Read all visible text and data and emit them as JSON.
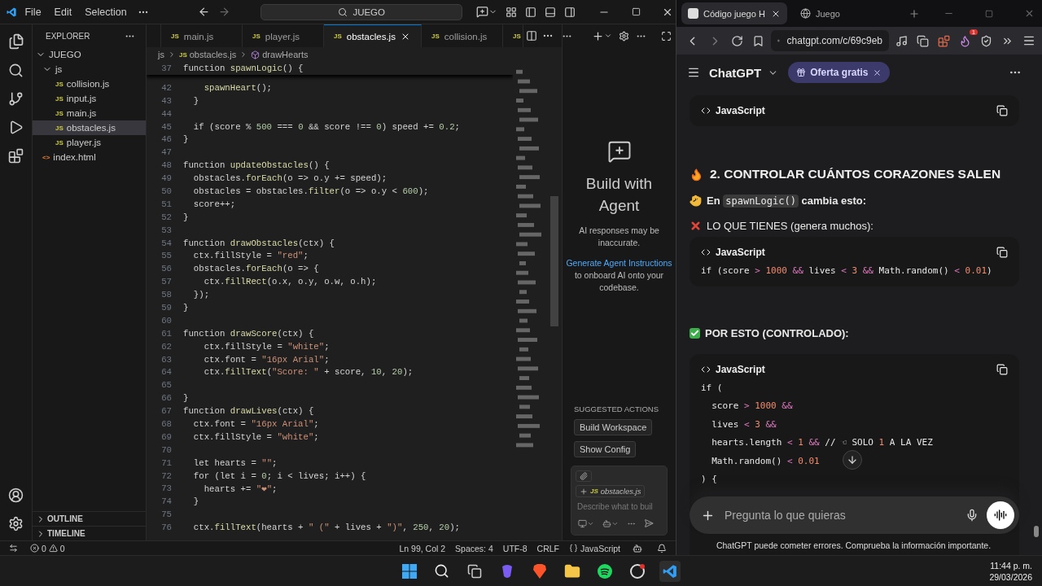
{
  "vscode": {
    "menu": [
      "File",
      "Edit",
      "Selection"
    ],
    "search": "JUEGO",
    "explorer": {
      "title": "EXPLORER",
      "root": {
        "label": "JUEGO",
        "expanded": true,
        "children": [
          {
            "label": "js",
            "expanded": true,
            "children": [
              {
                "label": "collision.js",
                "icon": "JS",
                "selected": false
              },
              {
                "label": "input.js",
                "icon": "JS",
                "selected": false
              },
              {
                "label": "main.js",
                "icon": "JS",
                "selected": false
              },
              {
                "label": "obstacles.js",
                "icon": "JS",
                "selected": true
              },
              {
                "label": "player.js",
                "icon": "JS",
                "selected": false
              }
            ]
          },
          {
            "label": "index.html",
            "icon": "<>",
            "selected": false
          }
        ]
      },
      "sections": [
        {
          "label": "OUTLINE",
          "expanded": false
        },
        {
          "label": "TIMELINE",
          "expanded": false
        }
      ]
    },
    "tabs": [
      {
        "label": "main.js",
        "icon": "JS",
        "selected": false
      },
      {
        "label": "player.js",
        "icon": "JS",
        "selected": false
      },
      {
        "label": "obstacles.js",
        "icon": "JS",
        "selected": true
      },
      {
        "label": "collision.js",
        "icon": "JS",
        "selected": false
      },
      {
        "icon": "JS",
        "selected": false
      }
    ],
    "breadcrumb": [
      {
        "label": "js"
      },
      {
        "label": "obstacles.js",
        "icon": "JS"
      },
      {
        "label": "drawHearts",
        "kind": "symbol"
      }
    ],
    "sticky": {
      "n": "37",
      "code": "function spawnLogic() {"
    },
    "lines": [
      {
        "n": "42",
        "code": "    spawnHeart();"
      },
      {
        "n": "43",
        "code": "  }"
      },
      {
        "n": "44"
      },
      {
        "n": "45",
        "code": "  if (score % 500 === 0 && score !== 0) speed += 0.2;"
      },
      {
        "n": "46",
        "code": "}"
      },
      {
        "n": "47"
      },
      {
        "n": "48",
        "code": "function updateObstacles() {"
      },
      {
        "n": "49",
        "code": "  obstacles.forEach(o => o.y += speed);"
      },
      {
        "n": "50",
        "code": "  obstacles = obstacles.filter(o => o.y < 600);"
      },
      {
        "n": "51",
        "code": "  score++;"
      },
      {
        "n": "52",
        "code": "}"
      },
      {
        "n": "53"
      },
      {
        "n": "54",
        "code": "function drawObstacles(ctx) {"
      },
      {
        "n": "55",
        "code": "  ctx.fillStyle = \"red\";"
      },
      {
        "n": "56",
        "code": "  obstacles.forEach(o => {"
      },
      {
        "n": "57",
        "code": "    ctx.fillRect(o.x, o.y, o.w, o.h);"
      },
      {
        "n": "58",
        "code": "  });"
      },
      {
        "n": "59",
        "code": "}"
      },
      {
        "n": "60"
      },
      {
        "n": "61",
        "code": "function drawScore(ctx) {"
      },
      {
        "n": "62",
        "code": "    ctx.fillStyle = \"white\";"
      },
      {
        "n": "63",
        "code": "    ctx.font = \"16px Arial\";"
      },
      {
        "n": "64",
        "code": "    ctx.fillText(\"Score: \" + score, 10, 20);"
      },
      {
        "n": "65"
      },
      {
        "n": "66",
        "code": "}"
      },
      {
        "n": "67",
        "code": "function drawLives(ctx) {"
      },
      {
        "n": "68",
        "code": "  ctx.font = \"16px Arial\";"
      },
      {
        "n": "69",
        "code": "  ctx.fillStyle = \"white\";"
      },
      {
        "n": "70"
      },
      {
        "n": "71",
        "code": "  let hearts = \"\";"
      },
      {
        "n": "72",
        "code": "  for (let i = 0; i < lives; i++) {"
      },
      {
        "n": "73",
        "code": "    hearts += \"❤\";"
      },
      {
        "n": "74",
        "code": "  }"
      },
      {
        "n": "75"
      },
      {
        "n": "76",
        "code": "  ctx.fillText(hearts + \" (\" + lives + \")\", 250, 20);"
      }
    ],
    "agent": {
      "title": "Build with Agent",
      "note": "AI responses may be inaccurate.",
      "link": "Generate Agent Instructions",
      "link_after": "to onboard AI onto your codebase.",
      "actions_title": "SUGGESTED ACTIONS",
      "actions": [
        "Build Workspace",
        "Show Config"
      ],
      "context": {
        "icon": "JS",
        "file": "obstacles.js"
      },
      "placeholder": "Describe what to buil"
    },
    "status_bar": {
      "errors": "0",
      "warnings": "0",
      "items": [
        "Ln 99, Col 2",
        "Spaces: 4",
        "UTF-8",
        "CRLF"
      ],
      "language": "JavaScript"
    }
  },
  "browser": {
    "tabs": [
      {
        "label": "Código juego H",
        "selected": true
      },
      {
        "label": "Juego",
        "selected": false
      }
    ],
    "url": "chatgpt.com/c/69c9eb",
    "extension_badge": "1",
    "chat": {
      "title": "ChatGPT",
      "offer": "Oferta gratis",
      "blocks": [
        {
          "kind": "code",
          "language": "JavaScript"
        },
        {
          "kind": "section",
          "text": "2. CONTROLAR CUÁNTOS CORAZONES SALEN"
        },
        {
          "kind": "instruction",
          "text": "En",
          "code": "spawnLogic()",
          "after": "cambia esto:"
        },
        {
          "kind": "bad",
          "text": "LO QUE TIENES (genera muchos):"
        },
        {
          "kind": "code",
          "language": "JavaScript",
          "lines": [
            "if (score > 1000 && lives < 3 && Math.random() < 0.01)"
          ]
        },
        {
          "kind": "good",
          "text": "POR ESTO (CONTROLADO):"
        },
        {
          "kind": "code",
          "language": "JavaScript",
          "lines": [
            "if (",
            "  score > 1000 &&",
            "  lives < 3 &&",
            "  hearts.length < 1 && // ☜ SOLO 1 A LA VEZ",
            "  Math.random() < 0.01",
            ") {"
          ]
        }
      ],
      "placeholder": "Pregunta lo que quieras",
      "disclaimer": "ChatGPT puede cometer errores. Comprueba la información importante."
    }
  },
  "taskbar": {
    "time": "11:44 p. m.",
    "date": "29/03/2026"
  }
}
